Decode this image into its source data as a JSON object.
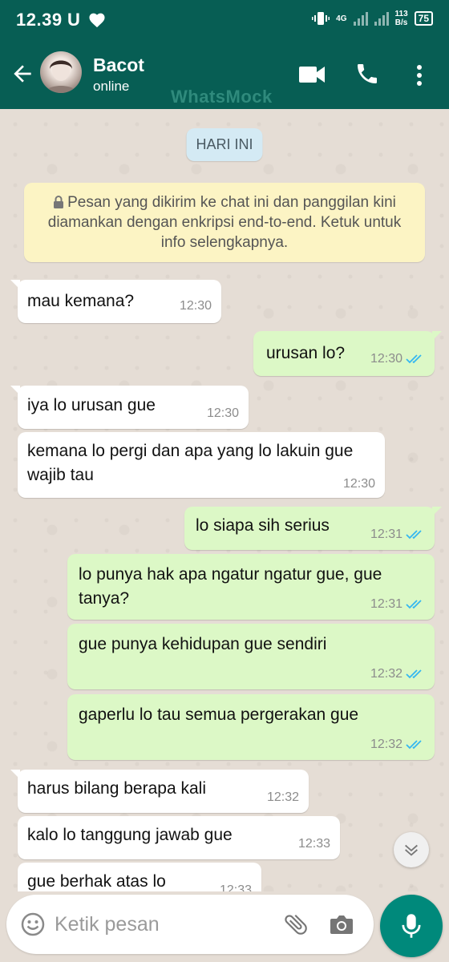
{
  "status_bar": {
    "time": "12.39",
    "left_icons": [
      "U",
      "heart-icon"
    ],
    "network_type": "4G",
    "speed_value": "113",
    "speed_unit": "B/s",
    "battery": "75"
  },
  "header": {
    "contact_name": "Bacot",
    "contact_status": "online",
    "watermark": "WhatsMock",
    "icons": [
      "back-arrow-icon",
      "video-call-icon",
      "phone-icon",
      "more-icon"
    ]
  },
  "chat": {
    "date_chip": "HARI INI",
    "encryption_notice": "Pesan yang dikirim ke chat ini dan panggilan kini diamankan dengan enkripsi end-to-end. Ketuk untuk info selengkapnya.",
    "messages": [
      {
        "direction": "in",
        "text": "mau kemana?",
        "time": "12:30"
      },
      {
        "direction": "out",
        "text": "urusan lo?",
        "time": "12:30",
        "status": "read"
      },
      {
        "direction": "in",
        "text": "iya lo urusan gue",
        "time": "12:30"
      },
      {
        "direction": "in",
        "text": "kemana lo pergi dan apa yang lo lakuin gue wajib tau",
        "time": "12:30"
      },
      {
        "direction": "out",
        "text": "lo siapa sih serius",
        "time": "12:31",
        "status": "read"
      },
      {
        "direction": "out",
        "text": "lo punya hak apa ngatur ngatur gue, gue tanya?",
        "time": "12:31",
        "status": "read"
      },
      {
        "direction": "out",
        "text": "gue punya kehidupan gue sendiri",
        "time": "12:32",
        "status": "read"
      },
      {
        "direction": "out",
        "text": "gaperlu lo tau semua pergerakan gue",
        "time": "12:32",
        "status": "read"
      },
      {
        "direction": "in",
        "text": "harus bilang berapa kali",
        "time": "12:32"
      },
      {
        "direction": "in",
        "text": "kalo lo tanggung jawab gue",
        "time": "12:33"
      },
      {
        "direction": "in",
        "text": "gue berhak atas lo",
        "time": "12:33"
      }
    ]
  },
  "input_bar": {
    "placeholder": "Ketik pesan",
    "icons": [
      "emoji-icon",
      "attach-icon",
      "camera-icon",
      "mic-icon"
    ]
  },
  "colors": {
    "header": "#075e54",
    "chat_bg": "#e5ddd5",
    "outgoing_bubble": "#dcf8c6",
    "incoming_bubble": "#ffffff",
    "read_ticks": "#34b7f1",
    "mic_button": "#00897b",
    "notice_bg": "#fcf4c4",
    "date_chip_bg": "#d4eaf4"
  }
}
